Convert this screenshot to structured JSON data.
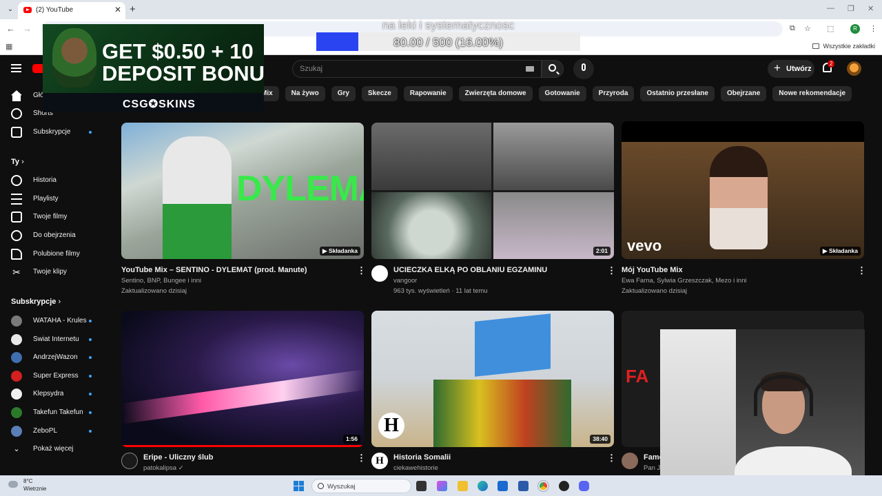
{
  "browser": {
    "tab_title": "(2) YouTube",
    "tab_close": "✕",
    "new_tab": "+",
    "bookmarks_all": "Wszystkie zakładki",
    "profile_initial": "R"
  },
  "masthead": {
    "search_placeholder": "Szukaj",
    "create_label": "Utwórz",
    "notifications_count": "2"
  },
  "chips": [
    "Mix",
    "Na żywo",
    "Gry",
    "Skecze",
    "Rapowanie",
    "Zwierzęta domowe",
    "Gotowanie",
    "Przyroda",
    "Ostatnio przesłane",
    "Obejrzane",
    "Nowe rekomendacje"
  ],
  "sidebar": {
    "main": [
      {
        "label": "Główna",
        "icon": "home-icon"
      },
      {
        "label": "Shorts",
        "icon": "shorts-icon"
      },
      {
        "label": "Subskrypcje",
        "icon": "subscriptions-icon"
      }
    ],
    "you_heading": "Ty",
    "you": [
      {
        "label": "Historia",
        "icon": "history-icon"
      },
      {
        "label": "Playlisty",
        "icon": "playlists-icon"
      },
      {
        "label": "Twoje filmy",
        "icon": "your-videos-icon"
      },
      {
        "label": "Do obejrzenia",
        "icon": "watch-later-icon"
      },
      {
        "label": "Polubione filmy",
        "icon": "liked-icon"
      },
      {
        "label": "Twoje klipy",
        "icon": "clips-icon"
      }
    ],
    "subs_heading": "Subskrypcje",
    "subscriptions": [
      {
        "label": "WATAHA - Kruleski",
        "color": "#7a7a7a"
      },
      {
        "label": "Świat Internetu",
        "color": "#e8e8e8"
      },
      {
        "label": "AndrzejWazon",
        "color": "#3f6fb0"
      },
      {
        "label": "Super Express",
        "color": "#d42020"
      },
      {
        "label": "Klepsydra",
        "color": "#f0f0f0"
      },
      {
        "label": "Takefun Takefun",
        "color": "#2a7a2a"
      },
      {
        "label": "ZeboPL",
        "color": "#5a7fb8"
      }
    ],
    "show_more": "Pokaż więcej"
  },
  "videos": [
    {
      "title": "YouTube Mix – SENTINO - DYLEMAT (prod. Manute)",
      "meta1": "Sentino, BNP, Bungee i inni",
      "meta2": "Zaktualizowano dzisiaj",
      "badge": "Składanka",
      "thumb_text": "DYLEMAT"
    },
    {
      "title": "UCIECZKA ELKĄ PO OBLANIU EGZAMINU",
      "meta1": "vangoor",
      "meta2": "963 tys. wyświetleń · 11 lat temu",
      "badge": "2:01"
    },
    {
      "title": "Mój YouTube Mix",
      "meta1": "Ewa Farna, Sylwia Grzeszczak, Mezo i inni",
      "meta2": "Zaktualizowano dzisiaj",
      "badge": "Składanka",
      "thumb_text": "vevo"
    },
    {
      "title": "Eripe - Uliczny ślub",
      "meta1": "patokalipsa",
      "badge": "1:56"
    },
    {
      "title": "Historia Somalii",
      "meta1": "ciekawehistorie",
      "badge": "38:40",
      "thumb_text": "H"
    },
    {
      "title": "Fame",
      "meta1": "Pan J",
      "thumb_text": "FA"
    }
  ],
  "overlays": {
    "ad_line1": "GET $0.50 + 10",
    "ad_line2": "DEPOSIT BONU",
    "ad_brand": "CSG✪SKINS",
    "goal_label": "na leki i systematycznosc",
    "goal_text": "80.00 / 500 (16.00%)",
    "goal_fraction": 0.16
  },
  "taskbar": {
    "temp": "8°C",
    "weather": "Wietrznie",
    "search_label": "Wyszukaj"
  },
  "colors": {
    "yt_red": "#ff0000",
    "bg": "#0f0f0f",
    "goal_blue": "#2a44f2",
    "sub_dot": "#3ea6ff"
  }
}
